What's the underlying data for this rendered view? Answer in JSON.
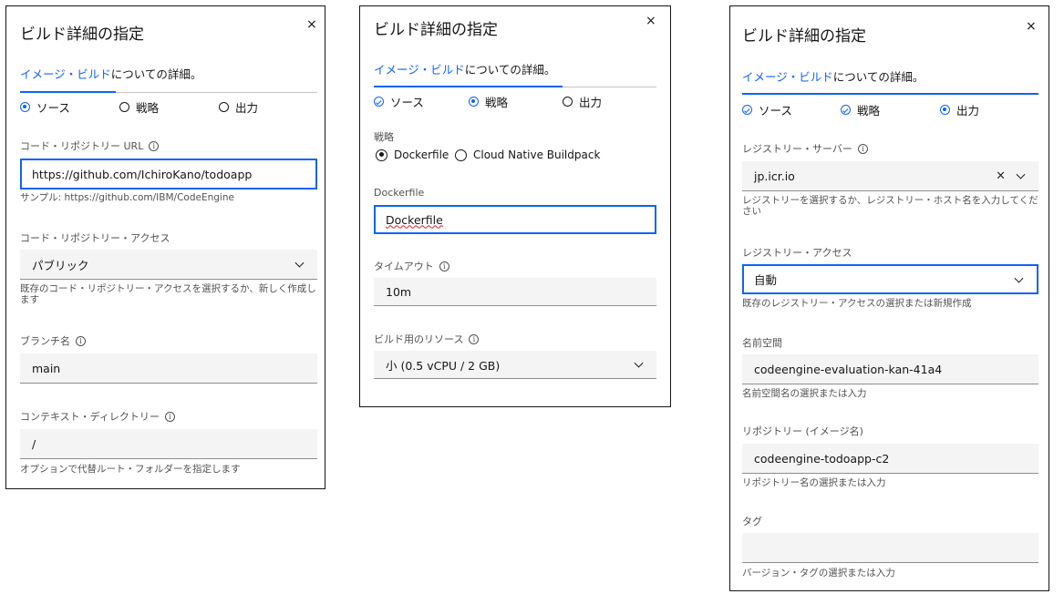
{
  "colors": {
    "accent": "#0f62fe",
    "text": "#161616",
    "helper": "#525252",
    "field_bg": "#f4f4f4"
  },
  "panels": [
    {
      "title": "ビルド詳細の指定",
      "close": "×",
      "subtitle_link": "イメージ・ビルド",
      "subtitle_rest": "についての詳細。",
      "steps": [
        {
          "label": "ソース",
          "state": "selected"
        },
        {
          "label": "戦略",
          "state": "empty"
        },
        {
          "label": "出力",
          "state": "empty"
        }
      ],
      "repo_url_label": "コード・リポジトリー URL",
      "repo_url_value": "https://github.com/IchiroKano/todoapp",
      "repo_url_helper": "サンプル: https://github.com/IBM/CodeEngine",
      "repo_access_label": "コード・リポジトリー・アクセス",
      "repo_access_value": "パブリック",
      "repo_access_helper": "既存のコード・リポジトリー・アクセスを選択するか、新しく作成します",
      "branch_label": "ブランチ名",
      "branch_value": "main",
      "context_label": "コンテキスト・ディレクトリー",
      "context_value": "/",
      "context_helper": "オプションで代替ルート・フォルダーを指定します"
    },
    {
      "title": "ビルド詳細の指定",
      "close": "×",
      "subtitle_link": "イメージ・ビルド",
      "subtitle_rest": "についての詳細。",
      "steps": [
        {
          "label": "ソース",
          "state": "done"
        },
        {
          "label": "戦略",
          "state": "selected"
        },
        {
          "label": "出力",
          "state": "empty"
        }
      ],
      "strategy_label": "戦略",
      "strategy_options": [
        {
          "label": "Dockerfile",
          "checked": true
        },
        {
          "label": "Cloud Native Buildpack",
          "checked": false
        }
      ],
      "dockerfile_label": "Dockerfile",
      "dockerfile_value": "Dockerfile",
      "timeout_label": "タイムアウト",
      "timeout_value": "10m",
      "resource_label": "ビルド用のリソース",
      "resource_value": "小 (0.5 vCPU / 2 GB)"
    },
    {
      "title": "ビルド詳細の指定",
      "close": "×",
      "subtitle_link": "イメージ・ビルド",
      "subtitle_rest": "についての詳細。",
      "steps": [
        {
          "label": "ソース",
          "state": "done"
        },
        {
          "label": "戦略",
          "state": "done"
        },
        {
          "label": "出力",
          "state": "selected"
        }
      ],
      "registry_server_label": "レジストリー・サーバー",
      "registry_server_value": "jp.icr.io",
      "registry_server_helper": "レジストリーを選択するか、レジストリー・ホスト名を入力してください",
      "registry_access_label": "レジストリー・アクセス",
      "registry_access_value": "自動",
      "registry_access_helper": "既存のレジストリー・アクセスの選択または新規作成",
      "namespace_label": "名前空間",
      "namespace_value": "codeengine-evaluation-kan-41a4",
      "namespace_helper": "名前空間名の選択または入力",
      "repository_label": "リポジトリー (イメージ名)",
      "repository_value": "codeengine-todoapp-c2",
      "repository_helper": "リポジトリー名の選択または入力",
      "tag_label": "タグ",
      "tag_value": "",
      "tag_helper": "バージョン・タグの選択または入力"
    }
  ]
}
